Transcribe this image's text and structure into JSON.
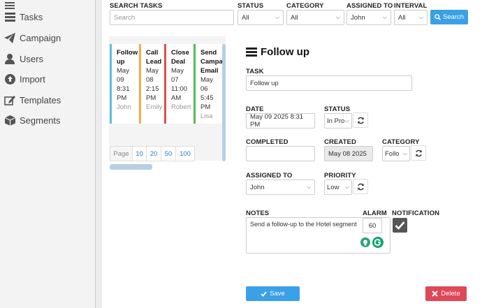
{
  "sidebar": {
    "items": [
      {
        "label": "Tasks",
        "icon": "tasks-icon"
      },
      {
        "label": "Campaign",
        "icon": "paper-plane-icon"
      },
      {
        "label": "Users",
        "icon": "user-icon"
      },
      {
        "label": "Import",
        "icon": "upload-circle-icon"
      },
      {
        "label": "Templates",
        "icon": "edit-icon"
      },
      {
        "label": "Segments",
        "icon": "cube-icon"
      }
    ]
  },
  "filters": {
    "search_label": "SEARCH TASKS",
    "search_placeholder": "Search",
    "status_label": "STATUS",
    "status_value": "All",
    "category_label": "CATEGORY",
    "category_value": "All",
    "assigned_label": "ASSIGNED TO",
    "assigned_value": "John",
    "interval_label": "INTERVAL",
    "interval_value": "All",
    "search_button": "Search"
  },
  "cards": [
    {
      "title": "Follow up",
      "date": "May 09 8:31 PM",
      "user": "John",
      "color": "#5bc0de"
    },
    {
      "title": "Call Lead",
      "date": "May 08 2:15 PM",
      "user": "Emily",
      "color": "#f0ad4e"
    },
    {
      "title": "Close Deal",
      "date": "May 07 11:00 AM",
      "user": "Robert",
      "color": "#d9534f"
    },
    {
      "title": "Send Campaign Email",
      "date": "May 06 5:45 PM",
      "user": "Lisa",
      "color": "#5cb85c"
    }
  ],
  "pager": {
    "label": "Page",
    "options": [
      "10",
      "20",
      "50",
      "100"
    ]
  },
  "detail": {
    "heading": "Follow up",
    "task_label": "TASK",
    "task_value": "Follow up",
    "date_label": "DATE",
    "date_value": "May 09 2025 8:31 PM",
    "status_label": "STATUS",
    "status_value": "In Pro",
    "completed_label": "COMPLETED",
    "completed_value": "",
    "created_label": "CREATED",
    "created_value": "May 08 2025",
    "category_label": "CATEGORY",
    "category_value": "Follo",
    "assigned_label": "ASSIGNED TO",
    "assigned_value": "John",
    "priority_label": "PRIORITY",
    "priority_value": "Low",
    "notes_label": "NOTES",
    "notes_value": "Send a follow-up to the Hotel segment",
    "alarm_label": "ALARM",
    "alarm_value": "60",
    "notification_label": "NOTIFICATION",
    "notification_checked": true,
    "save_button": "Save",
    "delete_button": "Delete"
  }
}
